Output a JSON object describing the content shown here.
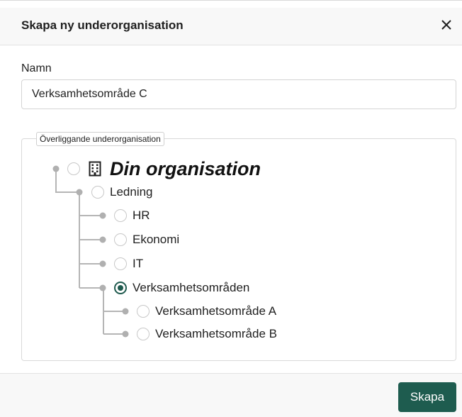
{
  "dialog": {
    "title": "Skapa ny underorganisation",
    "close_icon": "close-icon",
    "name_label": "Namn",
    "name_value": "Verksamhetsområde C",
    "parent_legend": "Överliggande underorganisation",
    "create_label": "Skapa",
    "accent_color": "#1e5c4f"
  },
  "tree": {
    "root": {
      "label": "Din organisation",
      "icon": "building-icon",
      "selected": false
    },
    "nodes": [
      {
        "label": "Ledning",
        "selected": false
      },
      {
        "label": "HR",
        "selected": false
      },
      {
        "label": "Ekonomi",
        "selected": false
      },
      {
        "label": "IT",
        "selected": false
      },
      {
        "label": "Verksamhetsområden",
        "selected": true
      },
      {
        "label": "Verksamhetsområde A",
        "selected": false
      },
      {
        "label": "Verksamhetsområde B",
        "selected": false
      }
    ]
  }
}
